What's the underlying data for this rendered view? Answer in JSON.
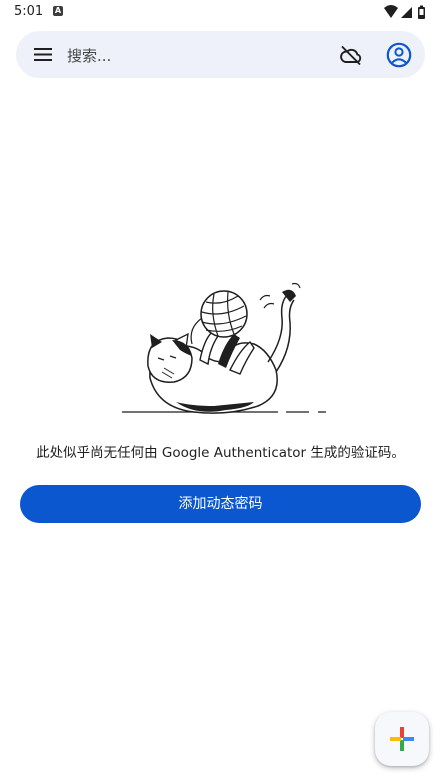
{
  "status_bar": {
    "time": "5:01",
    "notification_icon": "a-icon",
    "icons": [
      "wifi-icon",
      "signal-icon",
      "battery-icon"
    ]
  },
  "search": {
    "placeholder": "搜索...",
    "left_icon": "menu-icon",
    "sync_icon": "cloud-off-icon",
    "account_icon": "account-circle-icon"
  },
  "empty_state": {
    "illustration": "cat-playing-with-yarn-illustration",
    "message": "此处似乎尚无任何由 Google Authenticator 生成的验证码。",
    "button_label": "添加动态密码"
  },
  "fab": {
    "icon": "plus-multicolor-icon"
  },
  "colors": {
    "accent": "#0b57d0",
    "search_bg": "#eef1f9",
    "fab_blue": "#4285f4",
    "fab_red": "#ea4335",
    "fab_yellow": "#fbbc04",
    "fab_green": "#34a853"
  }
}
